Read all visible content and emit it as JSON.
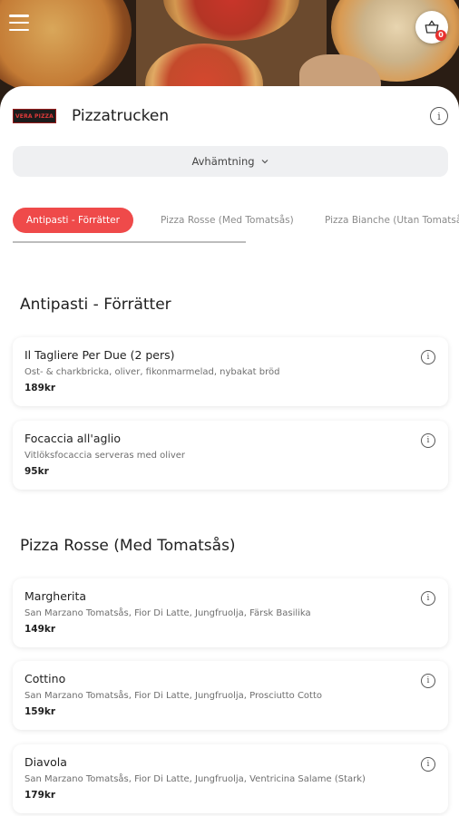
{
  "header": {
    "restaurant_name": "Pizzatrucken",
    "logo_text": "VERA PIZZA"
  },
  "cart": {
    "count": "0"
  },
  "delivery": {
    "selected": "Avhämtning"
  },
  "tabs": [
    {
      "label": "Antipasti - Förrätter",
      "active": true
    },
    {
      "label": "Pizza Rosse (Med Tomatsås)",
      "active": false
    },
    {
      "label": "Pizza Bianche (Utan Tomatsås)",
      "active": false
    }
  ],
  "sections": [
    {
      "title": "Antipasti - Förrätter",
      "items": [
        {
          "name": "Il Tagliere Per Due (2 pers)",
          "description": "Ost- & charkbricka, oliver, fikonmarmelad, nybakat bröd",
          "price": "189kr"
        },
        {
          "name": "Focaccia all'aglio",
          "description": "Vitlöksfocaccia serveras med oliver",
          "price": "95kr"
        }
      ]
    },
    {
      "title": "Pizza Rosse (Med Tomatsås)",
      "items": [
        {
          "name": "Margherita",
          "description": "San Marzano Tomatsås, Fior Di Latte, Jungfruolja, Färsk Basilika",
          "price": "149kr"
        },
        {
          "name": "Cottino",
          "description": "San Marzano Tomatsås, Fior Di Latte, Jungfruolja, Prosciutto Cotto",
          "price": "159kr"
        },
        {
          "name": "Diavola",
          "description": "San Marzano Tomatsås, Fior Di Latte, Jungfruolja, Ventricina Salame (Stark)",
          "price": "179kr"
        }
      ]
    }
  ],
  "colors": {
    "accent": "#ef4a4a",
    "badge": "#e8312f",
    "select_bg": "#eff0f2"
  },
  "icons": {
    "menu": "hamburger-menu-icon",
    "cart": "shopping-basket-icon",
    "info": "info-icon",
    "dropdown": "chevron-down-icon"
  }
}
